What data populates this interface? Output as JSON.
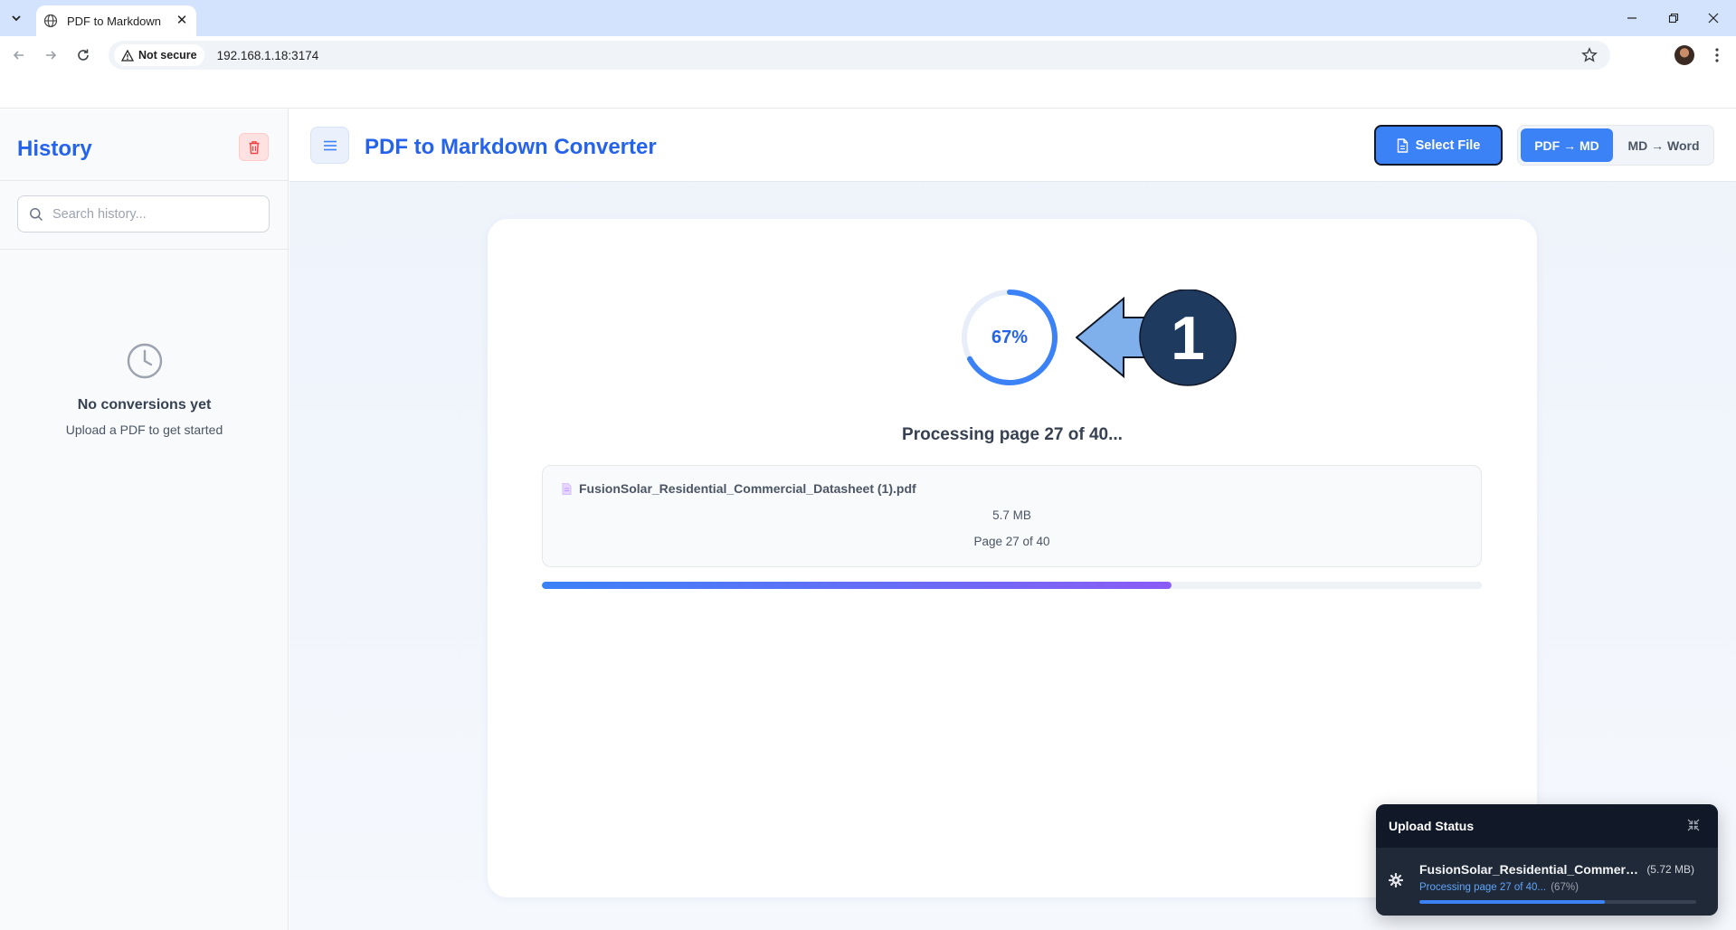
{
  "browser": {
    "tab_title": "PDF to Markdown",
    "security_label": "Not secure",
    "url": "192.168.1.18:3174"
  },
  "sidebar": {
    "title": "History",
    "search_placeholder": "Search history...",
    "empty_title": "No conversions yet",
    "empty_subtitle": "Upload a PDF to get started"
  },
  "header": {
    "title": "PDF to Markdown Converter",
    "select_file_label": "Select File",
    "modes": [
      {
        "label": "PDF → MD",
        "active": true
      },
      {
        "label": "MD → Word",
        "active": false
      }
    ]
  },
  "conversion": {
    "percent_label": "67%",
    "progress": 0.67,
    "status_text": "Processing page 27 of 40...",
    "file_name": "FusionSolar_Residential_Commercial_Datasheet (1).pdf",
    "file_size": "5.7 MB",
    "page_info": "Page 27 of 40",
    "annotation_number": "1"
  },
  "upload_status": {
    "title": "Upload Status",
    "file_name": "FusionSolar_Residential_Commercial_...",
    "file_size": "(5.72 MB)",
    "status_text": "Processing page 27 of 40...",
    "percent_text": "(67%)",
    "progress": 0.67
  },
  "colors": {
    "accent": "#2563eb",
    "button_blue": "#3b82f6",
    "progress_start": "#3b82f6",
    "progress_end": "#8b5cf6",
    "annotation_dark": "#1e3a5f",
    "annotation_arrow": "#7fb0ec"
  }
}
